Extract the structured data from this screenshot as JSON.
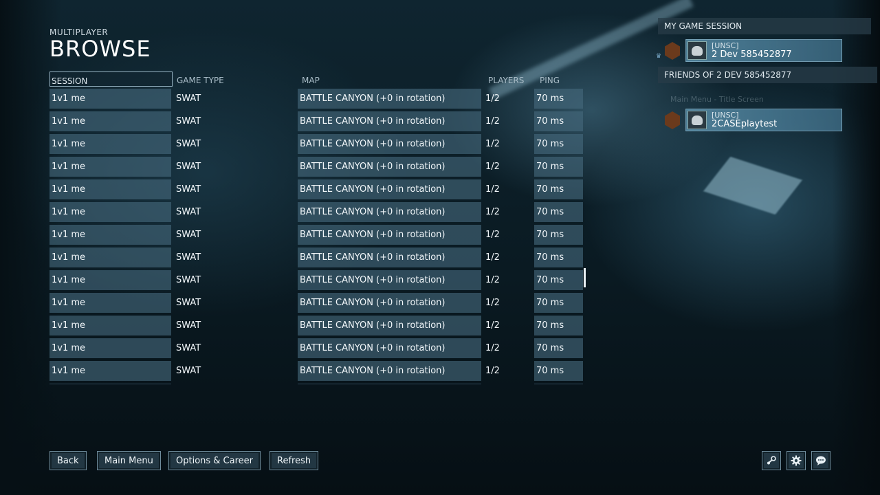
{
  "header": {
    "eyebrow": "MULTIPLAYER",
    "title": "BROWSE"
  },
  "table": {
    "columns": [
      "SESSION",
      "GAME TYPE",
      "MAP",
      "PLAYERS",
      "PING"
    ],
    "rows": [
      [
        "1v1 me",
        "SWAT",
        "BATTLE CANYON (+0 in rotation)",
        "1/2",
        "70 ms"
      ],
      [
        "1v1 me",
        "SWAT",
        "BATTLE CANYON (+0 in rotation)",
        "1/2",
        "70 ms"
      ],
      [
        "1v1 me",
        "SWAT",
        "BATTLE CANYON (+0 in rotation)",
        "1/2",
        "70 ms"
      ],
      [
        "1v1 me",
        "SWAT",
        "BATTLE CANYON (+0 in rotation)",
        "1/2",
        "70 ms"
      ],
      [
        "1v1 me",
        "SWAT",
        "BATTLE CANYON (+0 in rotation)",
        "1/2",
        "70 ms"
      ],
      [
        "1v1 me",
        "SWAT",
        "BATTLE CANYON (+0 in rotation)",
        "1/2",
        "70 ms"
      ],
      [
        "1v1 me",
        "SWAT",
        "BATTLE CANYON (+0 in rotation)",
        "1/2",
        "70 ms"
      ],
      [
        "1v1 me",
        "SWAT",
        "BATTLE CANYON (+0 in rotation)",
        "1/2",
        "70 ms"
      ],
      [
        "1v1 me",
        "SWAT",
        "BATTLE CANYON (+0 in rotation)",
        "1/2",
        "70 ms"
      ],
      [
        "1v1 me",
        "SWAT",
        "BATTLE CANYON (+0 in rotation)",
        "1/2",
        "70 ms"
      ],
      [
        "1v1 me",
        "SWAT",
        "BATTLE CANYON (+0 in rotation)",
        "1/2",
        "70 ms"
      ],
      [
        "1v1 me",
        "SWAT",
        "BATTLE CANYON (+0 in rotation)",
        "1/2",
        "70 ms"
      ],
      [
        "1v1 me",
        "SWAT",
        "BATTLE CANYON (+0 in rotation)",
        "1/2",
        "70 ms"
      ],
      [
        "",
        "",
        "",
        "",
        ""
      ]
    ]
  },
  "session": {
    "my_heading": "MY GAME SESSION",
    "my_member": {
      "tag": "[UNSC]",
      "name": "2 Dev 585452877"
    },
    "friends_heading": "FRIENDS OF 2 Dev 585452877",
    "friend_status": "Main Menu - Title Screen",
    "friend_member": {
      "tag": "[UNSC]",
      "name": "2CASEplaytest"
    }
  },
  "footer": {
    "back": "Back",
    "main_menu": "Main Menu",
    "options": "Options & Career",
    "refresh": "Refresh"
  },
  "icons": [
    "steam-icon",
    "gear-icon",
    "chat-icon"
  ],
  "colors": {
    "accent": "#6f8c9c",
    "row": "#46697d",
    "emblem": "#6b3a1c"
  }
}
